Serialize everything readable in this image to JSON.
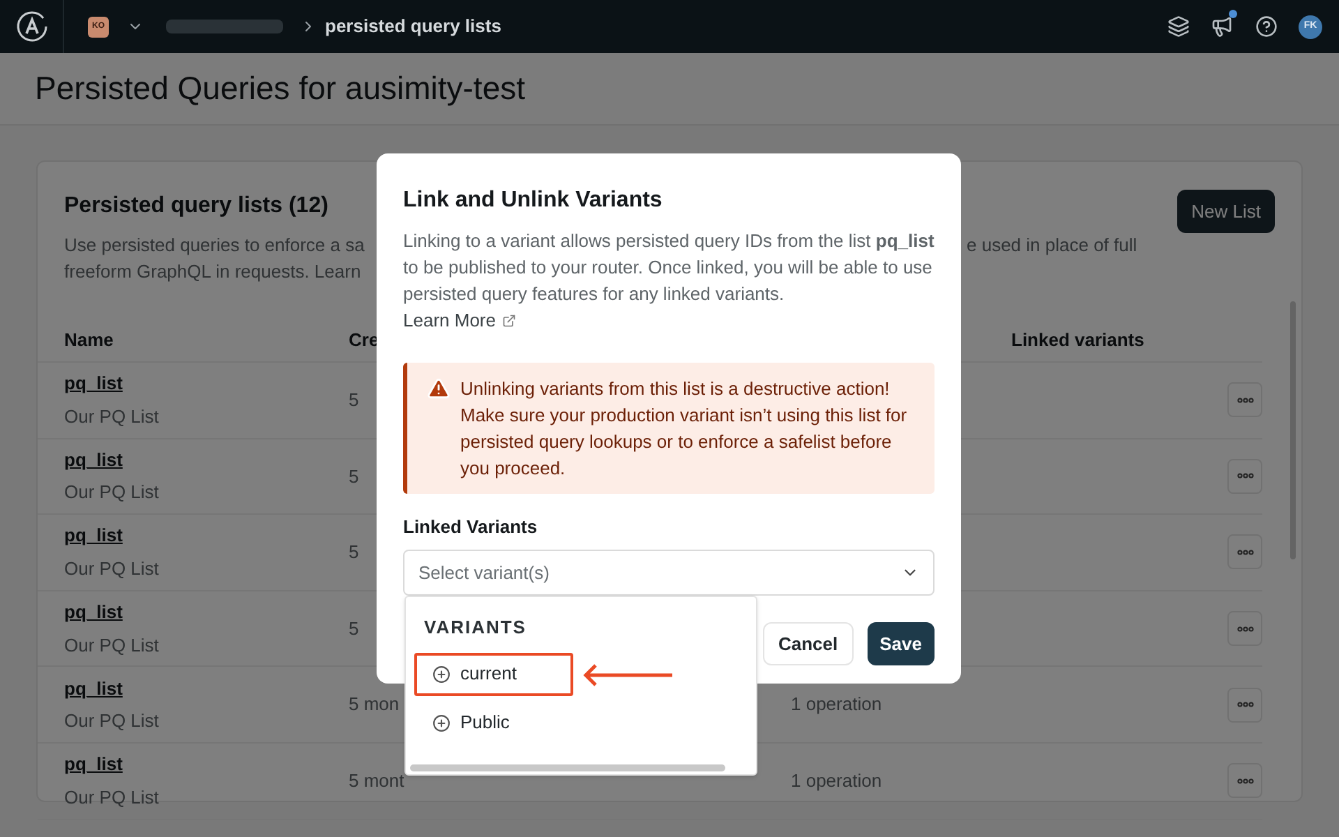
{
  "top_bar": {
    "org_badge": "KO",
    "breadcrumb": "persisted query lists",
    "avatar": "FK"
  },
  "page": {
    "title": "Persisted Queries for ausimity-test"
  },
  "card": {
    "title": "Persisted query lists (12)",
    "description_left": [
      "Use persisted queries to enforce a sa",
      "freeform GraphQL in requests. Learn"
    ],
    "description_right": "e used in place of full",
    "new_button": "New List",
    "columns": [
      "Name",
      "Cre",
      "Linked variants"
    ],
    "rows": [
      {
        "name": "pq_list",
        "description": "Our PQ List",
        "created": "5"
      },
      {
        "name": "pq_list",
        "description": "Our PQ List",
        "created": "5"
      },
      {
        "name": "pq_list",
        "description": "Our PQ List",
        "created": "5"
      },
      {
        "name": "pq_list",
        "description": "Our PQ List",
        "created": "5"
      },
      {
        "name": "pq_list",
        "description": "Our PQ List",
        "created": "5 mon",
        "operations": "1 operation"
      },
      {
        "name": "pq_list",
        "description": "Our PQ List",
        "created": "5 mont",
        "operations": "1 operation"
      }
    ]
  },
  "modal": {
    "title": "Link and Unlink Variants",
    "description": "Linking to a variant allows persisted query IDs from the list **pq_list** to be published to your router. Once linked, you will be able to use persisted query features for any linked variants.",
    "learn_more": "Learn More",
    "warning": "Unlinking variants from this list is a destructive action! Make sure your production variant isn’t using this list for persisted query lookups or to enforce a safelist before you proceed.",
    "field_label": "Linked Variants",
    "select": {
      "placeholder": "Select variant(s)"
    },
    "buttons": {
      "cancel": "Cancel",
      "save": "Save"
    }
  },
  "dropdown": {
    "heading": "VARIANTS",
    "options": [
      {
        "label": "current",
        "highlighted": true
      },
      {
        "label": "Public",
        "highlighted": false
      }
    ]
  }
}
